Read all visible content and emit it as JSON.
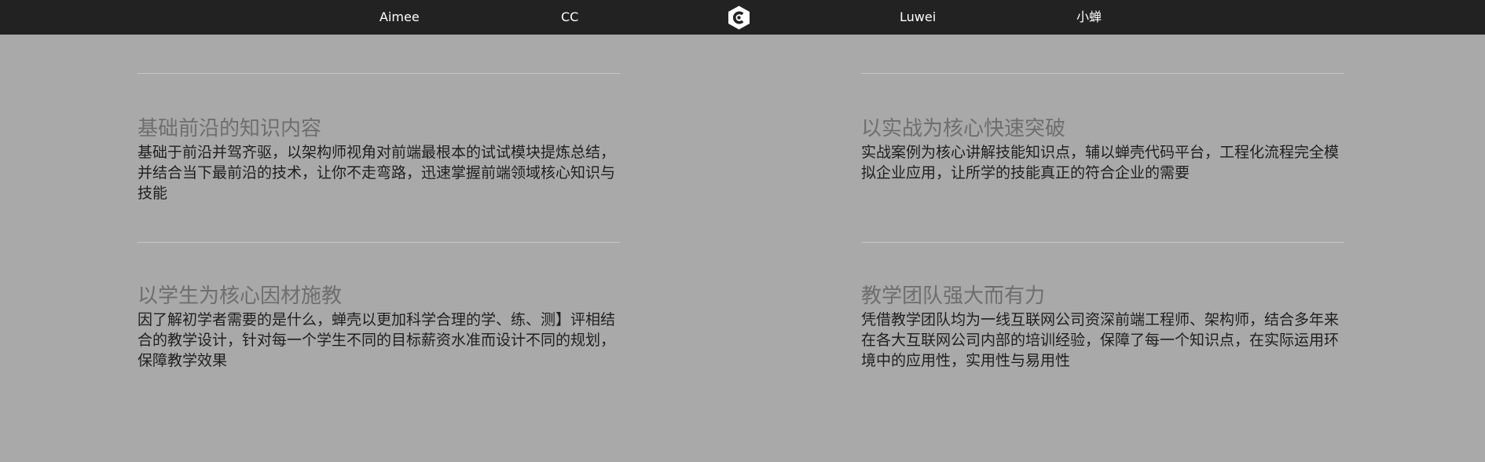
{
  "nav": {
    "items": [
      {
        "label": "Aimee"
      },
      {
        "label": "CC"
      },
      {
        "label": "Luwei"
      },
      {
        "label": "小蝉"
      }
    ],
    "logo_icon": "hexagon-c-logo-icon",
    "background_color": "#222222"
  },
  "features": [
    {
      "title": "基础前沿的知识内容",
      "description": "基础于前沿并驾齐驱，以架构师视角对前端最根本的试试模块提炼总结，并结合当下最前沿的技术，让你不走弯路，迅速掌握前端领域核心知识与技能"
    },
    {
      "title": "以实战为核心快速突破",
      "description": "实战案例为核心讲解技能知识点，辅以蝉壳代码平台，工程化流程完全模拟企业应用，让所学的技能真正的符合企业的需要"
    },
    {
      "title": "以学生为核心因材施教",
      "description": "因了解初学者需要的是什么，蝉壳以更加科学合理的学、练、测】评相结合的教学设计，针对每一个学生不同的目标薪资水准而设计不同的规划，保障教学效果"
    },
    {
      "title": "教学团队强大而有力",
      "description": "凭借教学团队均为一线互联网公司资深前端工程师、架构师，结合多年来在各大互联网公司内部的培训经验，保障了每一个知识点，在实际运用环境中的应用性，实用性与易用性"
    }
  ],
  "colors": {
    "page_background": "#a9a9a9",
    "title_text": "#6e6e6e",
    "body_text": "#1f1f1f",
    "divider": "#c6c6c6"
  }
}
